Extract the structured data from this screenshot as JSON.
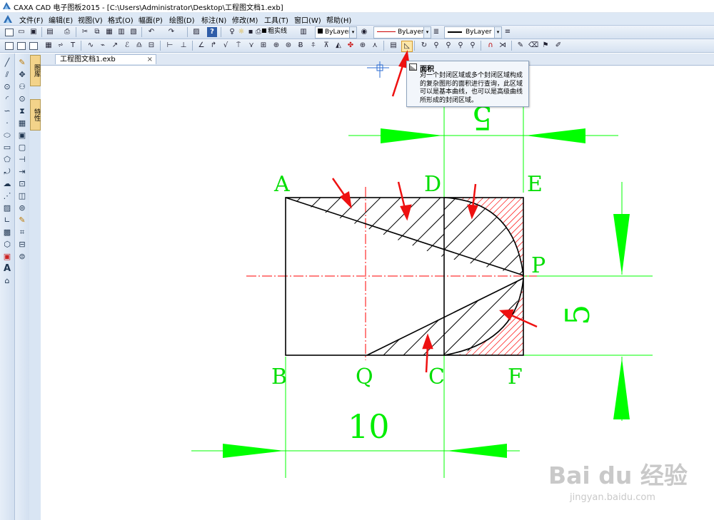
{
  "window": {
    "title": "CAXA CAD 电子图板2015 - [C:\\Users\\Administrator\\Desktop\\工程图文档1.exb]"
  },
  "menu": [
    {
      "label": "文件(F)"
    },
    {
      "label": "编辑(E)"
    },
    {
      "label": "视图(V)"
    },
    {
      "label": "格式(O)"
    },
    {
      "label": "幅面(P)"
    },
    {
      "label": "绘图(D)"
    },
    {
      "label": "标注(N)"
    },
    {
      "label": "修改(M)"
    },
    {
      "label": "工具(T)"
    },
    {
      "label": "窗口(W)"
    },
    {
      "label": "帮助(H)"
    }
  ],
  "properties_toolbar": {
    "linetype_label": "粗实线",
    "layer_color": "ByLayer",
    "linestyle": "ByLayer",
    "lineweight": "ByLayer"
  },
  "side_tabs": [
    "图库",
    "特性"
  ],
  "document_tab": {
    "label": "工程图文档1.exb",
    "close": "×"
  },
  "tooltip": {
    "title": "面积",
    "body": "对一个封闭区域或多个封闭区域构成的复杂图形的面积进行查询，此区域可以是基本曲线，也可以是高级曲线所形成的封闭区域。"
  },
  "drawing": {
    "point_labels": {
      "A": "A",
      "B": "B",
      "D": "D",
      "E": "E",
      "P": "P",
      "Q": "Q",
      "C": "C",
      "F": "F"
    },
    "dimensions": {
      "bottom": "10",
      "top": "5",
      "right": "5"
    },
    "colors": {
      "outline": "#000000",
      "hatch_black": "#000000",
      "hatch_red": "#ff0000",
      "centerline": "#ff0000",
      "dimension": "#00ff00",
      "annotation_arrow": "#ee1111"
    }
  },
  "watermark": {
    "main": "Bai du 经验",
    "sub": "jingyan.baidu.com"
  }
}
